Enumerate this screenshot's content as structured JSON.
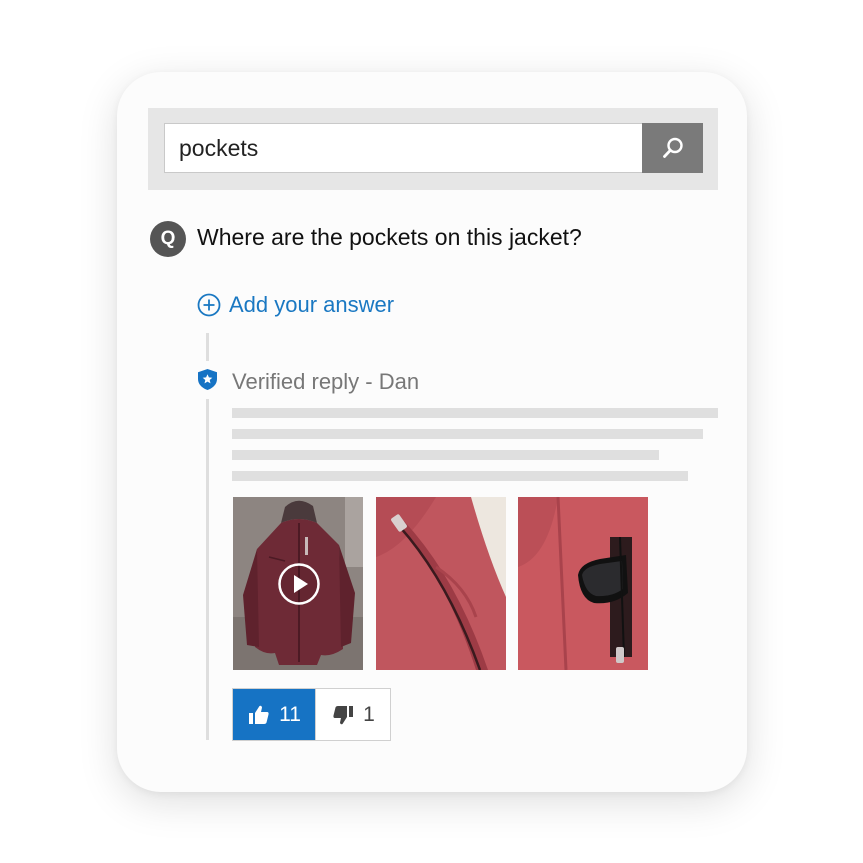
{
  "search": {
    "value": "pockets",
    "button_icon": "search-icon"
  },
  "question": {
    "icon_letter": "Q",
    "text": "Where are the pockets on this jacket?"
  },
  "add_answer": {
    "icon": "plus-circle-icon",
    "label": "Add your answer"
  },
  "answer": {
    "badge_icon": "verified-shield-icon",
    "author_label": "Verified reply - Dan",
    "media": [
      {
        "type": "video",
        "description_icon": "play-icon"
      },
      {
        "type": "image"
      },
      {
        "type": "image"
      }
    ],
    "votes": {
      "up_icon": "thumbs-up-icon",
      "up_count": "11",
      "down_icon": "thumbs-down-icon",
      "down_count": "1"
    }
  },
  "colors": {
    "accent": "#1673c4",
    "link": "#1a78c2",
    "jacket": "#b24a55"
  }
}
